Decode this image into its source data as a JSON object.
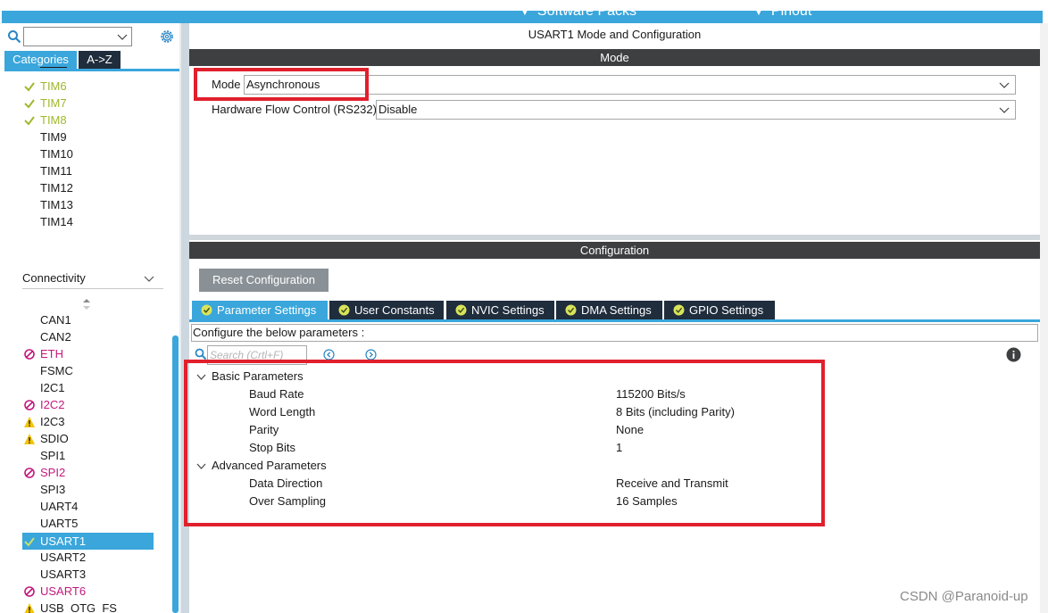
{
  "top_bar": {
    "tabs": [
      {
        "label": "Software Packs"
      },
      {
        "label": "Pinout"
      }
    ]
  },
  "sidebar": {
    "tabs": {
      "categories": "Categories",
      "az": "A->Z"
    },
    "timers": [
      {
        "label": "TIM6",
        "status": "enabled"
      },
      {
        "label": "TIM7",
        "status": "enabled"
      },
      {
        "label": "TIM8",
        "status": "enabled"
      },
      {
        "label": "TIM9",
        "status": "none"
      },
      {
        "label": "TIM10",
        "status": "none"
      },
      {
        "label": "TIM11",
        "status": "none"
      },
      {
        "label": "TIM12",
        "status": "none"
      },
      {
        "label": "TIM13",
        "status": "none"
      },
      {
        "label": "TIM14",
        "status": "none"
      }
    ],
    "connectivity_label": "Connectivity",
    "connectivity": [
      {
        "label": "CAN1",
        "status": "none"
      },
      {
        "label": "CAN2",
        "status": "none"
      },
      {
        "label": "ETH",
        "status": "disabled"
      },
      {
        "label": "FSMC",
        "status": "none"
      },
      {
        "label": "I2C1",
        "status": "none"
      },
      {
        "label": "I2C2",
        "status": "disabled"
      },
      {
        "label": "I2C3",
        "status": "warning"
      },
      {
        "label": "SDIO",
        "status": "warning"
      },
      {
        "label": "SPI1",
        "status": "none"
      },
      {
        "label": "SPI2",
        "status": "disabled"
      },
      {
        "label": "SPI3",
        "status": "none"
      },
      {
        "label": "UART4",
        "status": "none"
      },
      {
        "label": "UART5",
        "status": "none"
      },
      {
        "label": "USART1",
        "status": "selected"
      },
      {
        "label": "USART2",
        "status": "none"
      },
      {
        "label": "USART3",
        "status": "none"
      },
      {
        "label": "USART6",
        "status": "disabled"
      },
      {
        "label": "USB_OTG_FS",
        "status": "warning"
      }
    ]
  },
  "main": {
    "title": "USART1 Mode and Configuration",
    "mode_header": "Mode",
    "mode_label": "Mode",
    "mode_value": "Asynchronous",
    "flow_label": "Hardware Flow Control (RS232)",
    "flow_value": "Disable",
    "config_header": "Configuration",
    "reset_label": "Reset Configuration",
    "tabs": [
      {
        "label": "Parameter Settings"
      },
      {
        "label": "User Constants"
      },
      {
        "label": "NVIC Settings"
      },
      {
        "label": "DMA Settings"
      },
      {
        "label": "GPIO Settings"
      }
    ],
    "description": "Configure the below parameters :",
    "search_placeholder": "Search (Crtl+F)",
    "basic_group": "Basic Parameters",
    "basic_params": [
      {
        "name": "Baud Rate",
        "value": "115200 Bits/s"
      },
      {
        "name": "Word Length",
        "value": "8 Bits (including Parity)"
      },
      {
        "name": "Parity",
        "value": "None"
      },
      {
        "name": "Stop Bits",
        "value": "1"
      }
    ],
    "advanced_group": "Advanced Parameters",
    "advanced_params": [
      {
        "name": "Data Direction",
        "value": "Receive and Transmit"
      },
      {
        "name": "Over Sampling",
        "value": "16 Samples"
      }
    ]
  },
  "watermark": "CSDN @Paranoid-up",
  "colors": {
    "accent": "#3aa6db",
    "dark_tab": "#1f2d3d",
    "enabled_green": "#a1b72d",
    "disabled_magenta": "#c2197d",
    "warning_yellow": "#f5c400",
    "highlight_red": "#e0202c"
  }
}
